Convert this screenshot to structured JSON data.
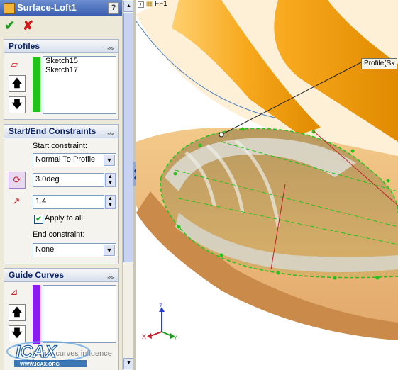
{
  "feature": {
    "title": "Surface-Loft1",
    "help_label": "?",
    "ok_symbol": "✔",
    "cancel_symbol": "✘"
  },
  "profiles": {
    "header": "Profiles",
    "items": [
      "Sketch15",
      "Sketch17"
    ],
    "color": "#22c21a"
  },
  "constraints": {
    "header": "Start/End Constraints",
    "start_label": "Start constraint:",
    "start_value": "Normal To Profile",
    "angle_value": "3.0deg",
    "length_value": "1.4",
    "apply_all_label": "Apply to all",
    "apply_all_checked": true,
    "end_label": "End constraint:",
    "end_value": "None"
  },
  "guide_curves": {
    "header": "Guide Curves",
    "color": "#8a1cf0",
    "influence_label": "Guide curves influence type:"
  },
  "viewport": {
    "tree_label": "FF1",
    "callout": "Profile(Sk",
    "axis_z": "Z",
    "axis_x": "X",
    "axis_y": "Y",
    "watermark": "ICAX",
    "watermark_url": "WWW.ICAX.ORG"
  },
  "colors": {
    "part_orange": "#f7a81c",
    "preview_green": "#27c21a",
    "titlebar_blue": "#3a5fb0"
  }
}
